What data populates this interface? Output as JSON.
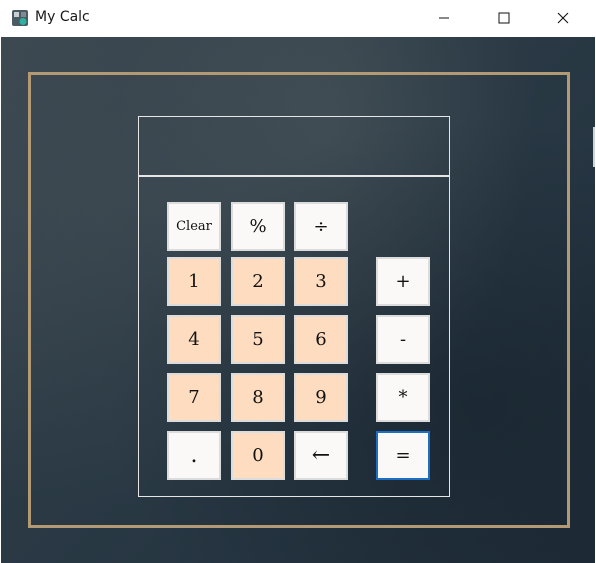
{
  "window": {
    "title": "My Calc"
  },
  "display": {
    "value": ""
  },
  "buttons": {
    "clear": "Clear",
    "percent": "%",
    "divide": "÷",
    "one": "1",
    "two": "2",
    "three": "3",
    "plus": "+",
    "four": "4",
    "five": "5",
    "six": "6",
    "minus": "-",
    "seven": "7",
    "eight": "8",
    "nine": "9",
    "multiply": "*",
    "dot": ".",
    "zero": "0",
    "backspace": "←",
    "equals": "="
  },
  "colors": {
    "digit_button": "#fddcbf",
    "operator_button": "#fbf8f8",
    "frame_border": "#b39a75",
    "focus_border": "#1c6fc4"
  }
}
